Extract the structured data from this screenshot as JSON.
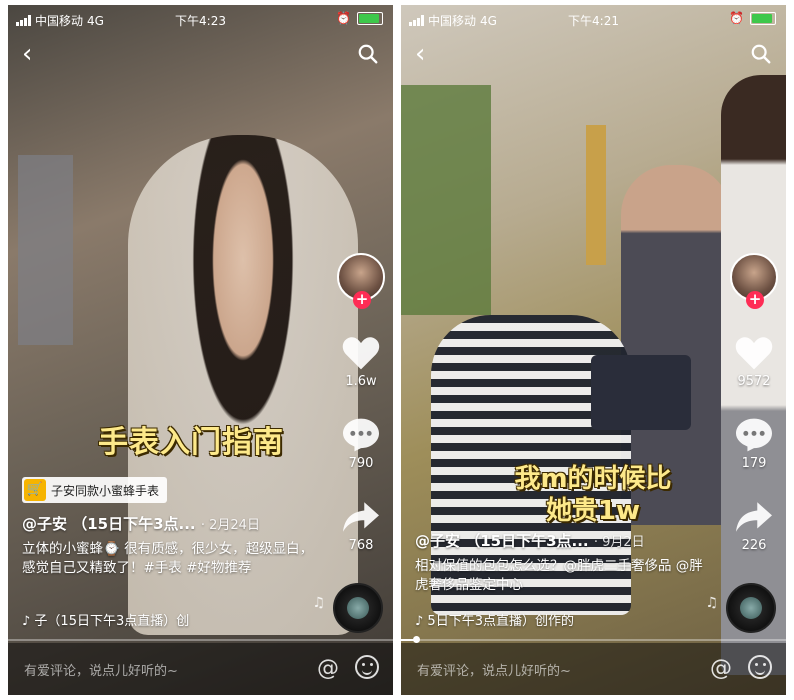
{
  "screens": [
    {
      "status": {
        "carrier": "中国移动",
        "network": "4G",
        "time": "下午4:23"
      },
      "overlay_title": "手表入门指南",
      "product_label": "子安同款小蜜蜂手表",
      "author": "@子安 （15日下午3点...",
      "date": "· 2月24日",
      "description": "立体的小蜜蜂⌚ 很有质感，很少女，超级显白，感觉自己又精致了！#手表 #好物推荐",
      "music": "♪ 子（15日下午3点直播）创",
      "likes": "1.6w",
      "comments": "790",
      "shares": "768",
      "progress": 0.0,
      "comment_placeholder": "有爱评论，说点儿好听的~"
    },
    {
      "status": {
        "carrier": "中国移动",
        "network": "4G",
        "time": "下午4:21"
      },
      "overlay_title": "我m的时候比她贵1w",
      "author": "@子安 （15日下午3点...",
      "date": "· 9月2日",
      "description": "相对保值的包包怎么选？@胖虎二手奢侈品 @胖虎奢侈品鉴定中心",
      "music": "♪ 5日下午3点直播）创作的",
      "likes": "9572",
      "comments": "179",
      "shares": "226",
      "progress": 0.04,
      "comment_placeholder": "有爱评论，说点儿好听的~"
    }
  ],
  "icons": {
    "back": "back-arrow-icon",
    "search": "search-icon",
    "heart": "heart-icon",
    "comment": "comment-bubble-icon",
    "share": "share-arrow-icon",
    "music_disc": "music-disc-icon",
    "at": "at-mention-icon",
    "emoji": "emoji-icon"
  },
  "colors": {
    "follow_button": "#fe2c55",
    "overlay_text": "#fde98a",
    "battery": "#3ec84b",
    "product_icon": "#f6b400"
  }
}
